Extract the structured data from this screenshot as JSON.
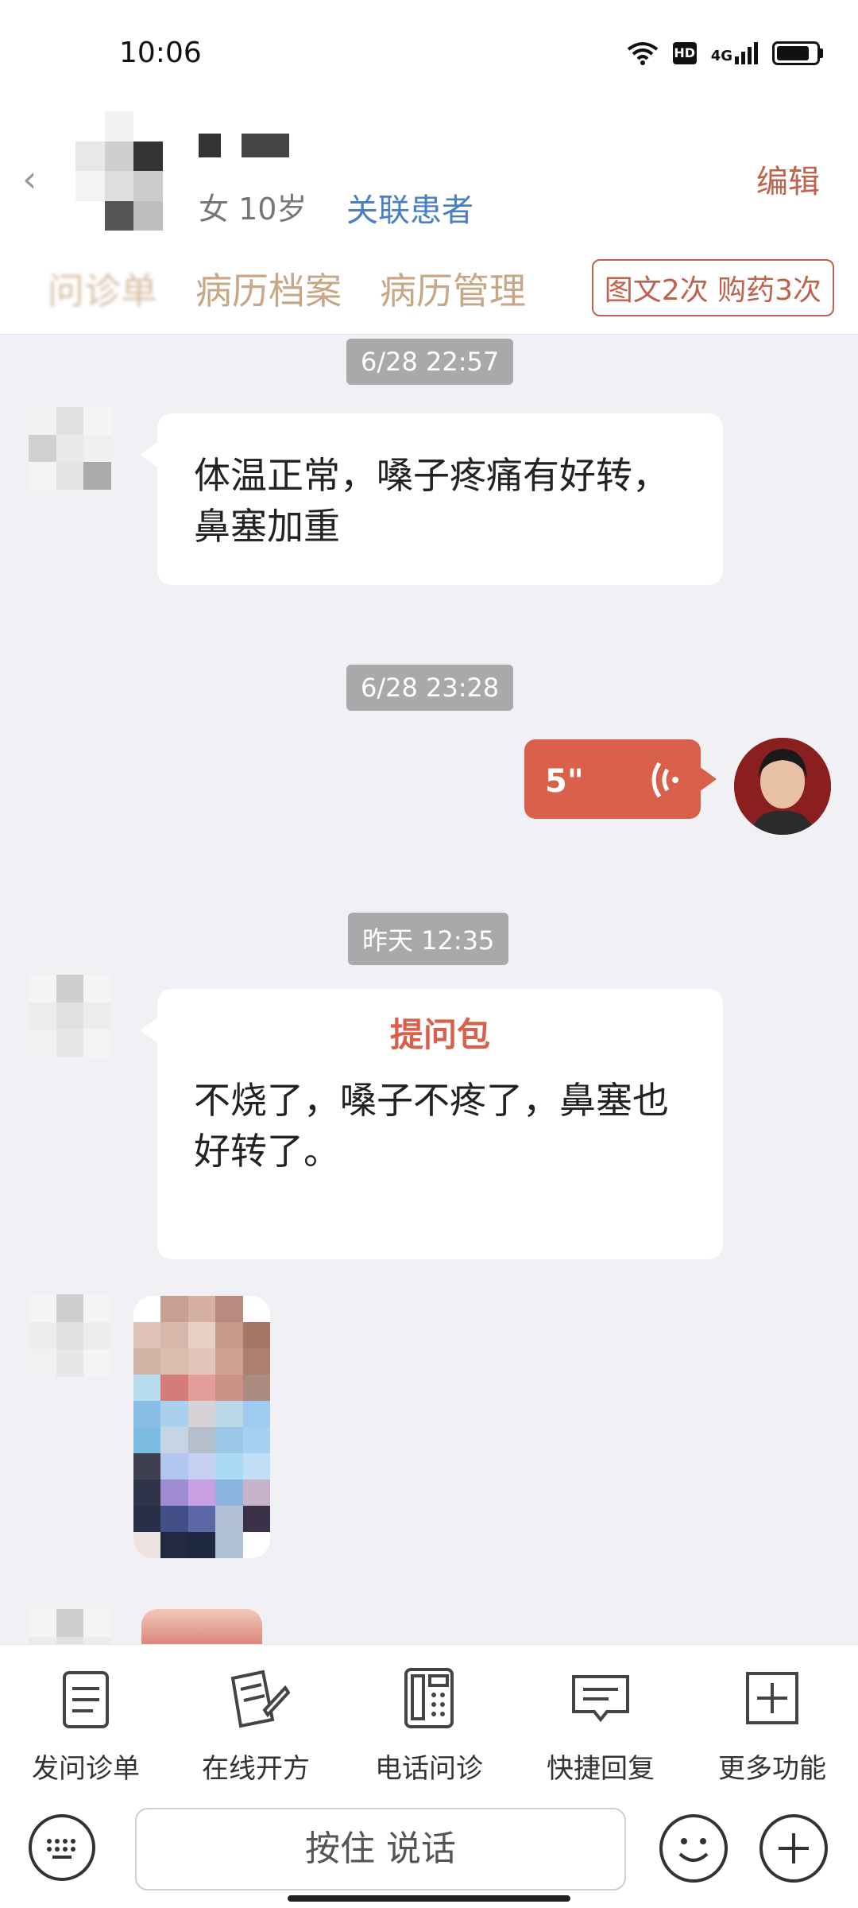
{
  "status_bar": {
    "time": "10:06",
    "network": "4G",
    "hd": "HD"
  },
  "header": {
    "patient_info": "女 10岁",
    "link_patient": "关联患者",
    "edit": "编辑",
    "tabs": [
      "问诊单",
      "病历档案",
      "病历管理"
    ],
    "order_badge": "图文2次 购药3次"
  },
  "chat": {
    "messages": [
      {
        "timestamp": "6/28 22:57",
        "text": "体温正常，嗓子疼痛有好转，鼻塞加重"
      },
      {
        "timestamp": "6/28 23:28",
        "voice_duration": "5\""
      },
      {
        "timestamp": "昨天 12:35",
        "title": "提问包",
        "text": "不烧了，嗓子不疼了，鼻塞也好转了。"
      }
    ]
  },
  "function_bar": {
    "items": [
      {
        "label": "发问诊单",
        "icon": "clipboard-icon"
      },
      {
        "label": "在线开方",
        "icon": "prescription-pen-icon"
      },
      {
        "label": "电话问诊",
        "icon": "phone-icon"
      },
      {
        "label": "快捷回复",
        "icon": "message-icon"
      },
      {
        "label": "更多功能",
        "icon": "plus-square-icon"
      }
    ]
  },
  "input_bar": {
    "talk_label": "按住 说话"
  }
}
